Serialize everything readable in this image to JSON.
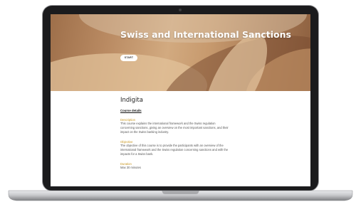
{
  "course": {
    "title": "Swiss and International Sanctions",
    "start_label": "START",
    "provider": "Indigita",
    "details_heading": "Course details",
    "sections": [
      {
        "label": "Description",
        "text": "This course explains the international framework and the Swiss regulation concerning sanctions, giving an overview on the most important sanctions, and their impact on the Swiss banking industry."
      },
      {
        "label": "Objective",
        "text": "The objective of this course is to provide the participants with an overview of the international framework and the Swiss regulation concerning sanctions and with the impacts for a Swiss bank."
      },
      {
        "label": "Duration",
        "text": "Max 30 minutes"
      }
    ]
  }
}
